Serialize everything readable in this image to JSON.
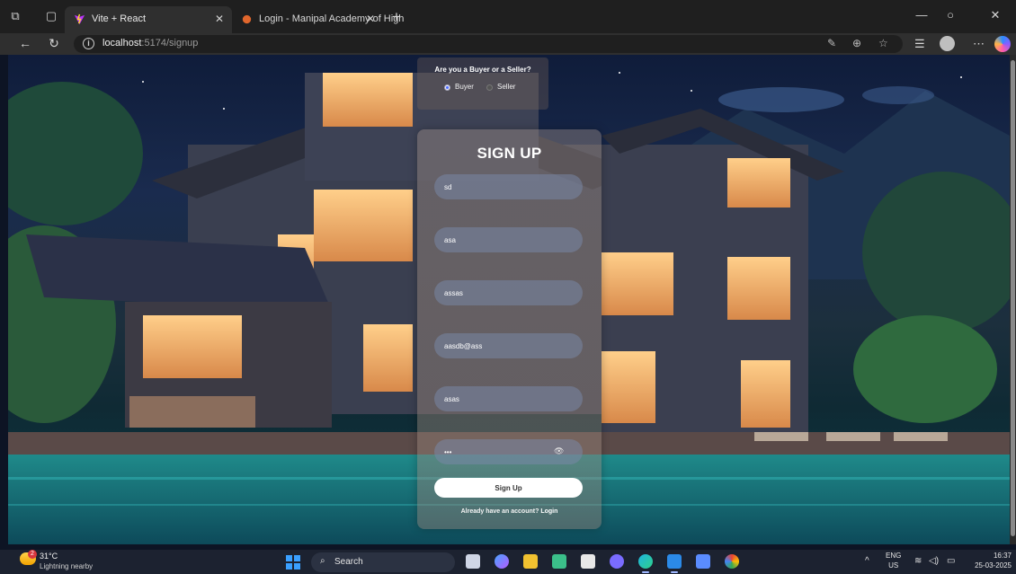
{
  "browser": {
    "tabs": [
      {
        "title": "Vite + React",
        "active": true
      },
      {
        "title": "Login - Manipal Academy of High",
        "active": false
      }
    ],
    "address": {
      "host": "localhost",
      "path": ":5174/signup"
    }
  },
  "role": {
    "question": "Are you a Buyer or a Seller?",
    "options": [
      "Buyer",
      "Seller"
    ],
    "selected": "Buyer"
  },
  "signup": {
    "title": "SIGN UP",
    "fields": [
      {
        "name": "field-1",
        "value": "sd"
      },
      {
        "name": "field-2",
        "value": "asa"
      },
      {
        "name": "field-3",
        "value": "assas"
      },
      {
        "name": "field-4",
        "value": "aasdb@ass"
      },
      {
        "name": "field-5",
        "value": "asas"
      },
      {
        "name": "password",
        "value": "•••"
      }
    ],
    "submit_label": "Sign Up",
    "login_prompt": "Already have an account?",
    "login_link": "Login"
  },
  "taskbar": {
    "weather_temp": "31°C",
    "weather_desc": "Lightning nearby",
    "weather_badge": "2",
    "search_label": "Search",
    "lang_top": "ENG",
    "lang_bottom": "US",
    "time": "16:37",
    "date": "25-03-2025"
  },
  "colors": {
    "card_tint": "#a8968c",
    "field_bg": "#7887a5",
    "button_bg": "#ffffff"
  }
}
